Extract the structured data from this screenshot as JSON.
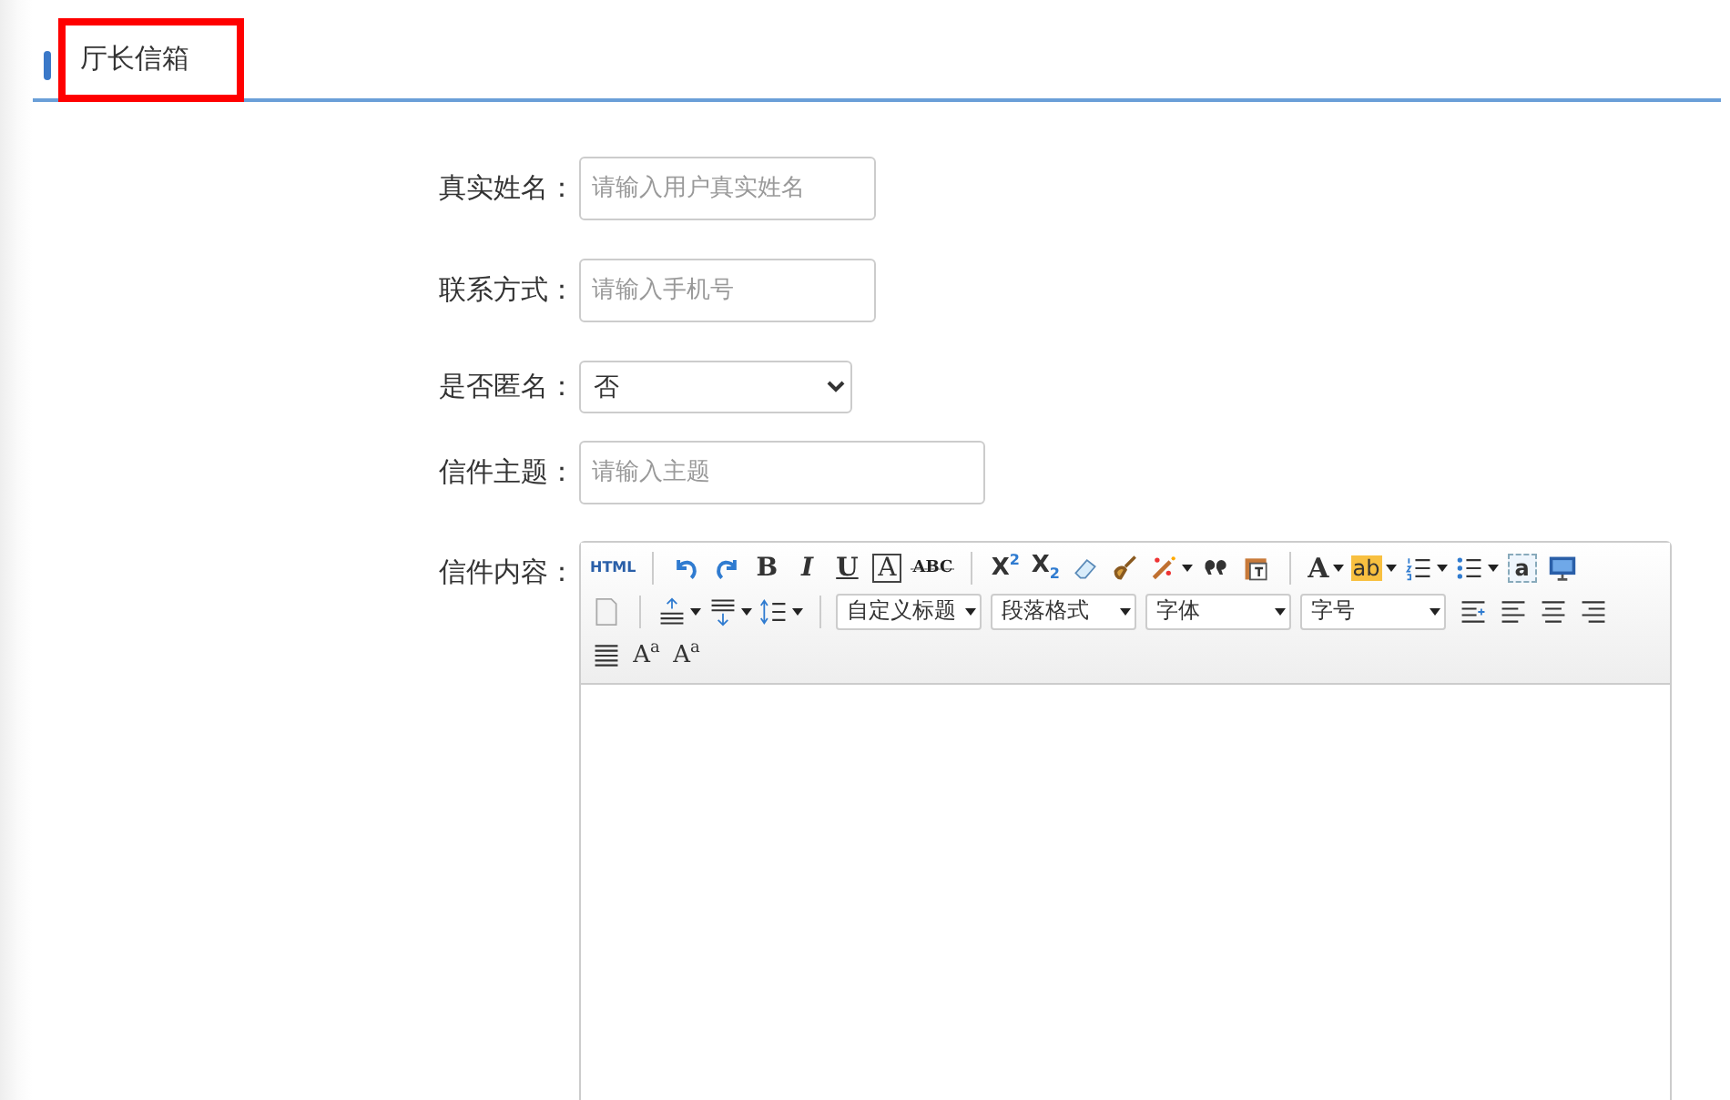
{
  "header": {
    "title": "厅长信箱",
    "highlighted": true
  },
  "form": {
    "fields": [
      {
        "kind": "text",
        "label": "真实姓名：",
        "placeholder": "请输入用户真实姓名"
      },
      {
        "kind": "text",
        "label": "联系方式：",
        "placeholder": "请输入手机号"
      },
      {
        "kind": "select",
        "label": "是否匿名：",
        "value": "否"
      },
      {
        "kind": "text",
        "label": "信件主题：",
        "placeholder": "请输入主题"
      }
    ],
    "editor": {
      "label": "信件内容：",
      "toolbar": [
        [
          {
            "kind": "html",
            "text": "HTML"
          },
          {
            "kind": "separator"
          },
          {
            "kind": "undo"
          },
          {
            "kind": "redo"
          },
          {
            "kind": "bold",
            "text": "B"
          },
          {
            "kind": "italic",
            "text": "I"
          },
          {
            "kind": "underline",
            "text": "U"
          },
          {
            "kind": "boxed",
            "text": "A"
          },
          {
            "kind": "strike",
            "text": "ABC"
          },
          {
            "kind": "separator"
          },
          {
            "kind": "script",
            "text": "X$^{2}$"
          },
          {
            "kind": "script",
            "text": "X$_{2}$"
          },
          {
            "kind": "eraser"
          },
          {
            "kind": "brush"
          },
          {
            "kind": "magic",
            "menu": true
          },
          {
            "kind": "quote"
          },
          {
            "kind": "paste"
          },
          {
            "kind": "separator"
          },
          {
            "kind": "fontcolor",
            "text": "A",
            "menu": true
          },
          {
            "kind": "highlight",
            "text": "ab",
            "menu": true
          },
          {
            "kind": "ol",
            "menu": true
          },
          {
            "kind": "ul",
            "menu": true
          },
          {
            "kind": "anchor",
            "text": "a"
          },
          {
            "kind": "monitor"
          }
        ],
        [
          {
            "kind": "page"
          },
          {
            "kind": "separator"
          },
          {
            "kind": "spacebefore",
            "menu": true
          },
          {
            "kind": "spaceafter",
            "menu": true
          },
          {
            "kind": "lineheight",
            "menu": true
          },
          {
            "kind": "separator"
          },
          {
            "kind": "select",
            "text": "自定义标题"
          },
          {
            "kind": "select",
            "text": "段落格式"
          },
          {
            "kind": "select",
            "text": "字体"
          },
          {
            "kind": "select",
            "text": "字号"
          },
          {
            "kind": "indent"
          },
          {
            "kind": "alignleft"
          },
          {
            "kind": "aligncenter"
          },
          {
            "kind": "alignright"
          }
        ],
        [
          {
            "kind": "justify"
          },
          {
            "kind": "casing",
            "text": "A$^{a}$"
          },
          {
            "kind": "casing",
            "text": "A$^{a}$"
          }
        ]
      ]
    }
  }
}
